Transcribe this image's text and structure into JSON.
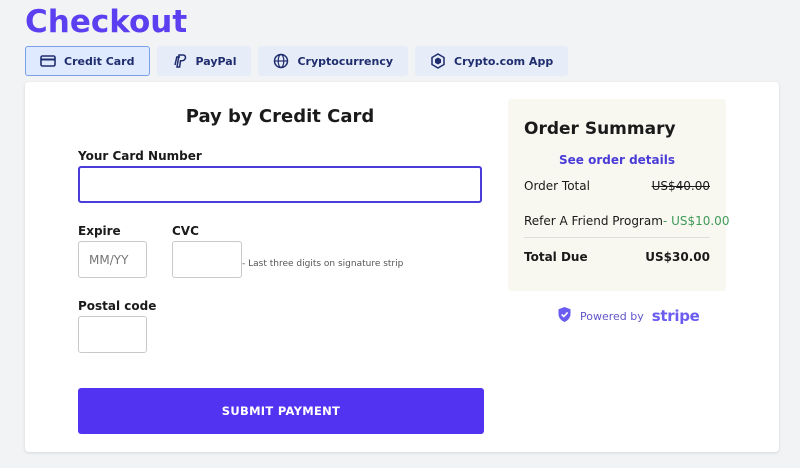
{
  "page": {
    "title": "Checkout"
  },
  "tabs": [
    {
      "label": "Credit Card",
      "icon": "credit-card-icon",
      "active": true
    },
    {
      "label": "PayPal",
      "icon": "paypal-icon",
      "active": false
    },
    {
      "label": "Cryptocurrency",
      "icon": "globe-icon",
      "active": false
    },
    {
      "label": "Crypto.com App",
      "icon": "crypto-com-icon",
      "active": false
    }
  ],
  "form": {
    "title": "Pay by Credit Card",
    "card_number": {
      "label": "Your Card Number",
      "value": "",
      "placeholder": ""
    },
    "expire": {
      "label": "Expire",
      "placeholder": "MM/YY"
    },
    "cvc": {
      "label": "CVC",
      "placeholder": "",
      "hint": "- Last three digits on signature strip"
    },
    "postal": {
      "label": "Postal code",
      "placeholder": ""
    },
    "submit_label": "SUBMIT PAYMENT"
  },
  "summary": {
    "title": "Order Summary",
    "details_link": "See order details",
    "order_total": {
      "label": "Order Total",
      "value": "US$40.00"
    },
    "referral": {
      "label": "Refer A Friend Program",
      "value": "- US$10.00"
    },
    "total_due": {
      "label": "Total Due",
      "value": "US$30.00"
    }
  },
  "powered_by": {
    "text": "Powered by",
    "brand": "stripe",
    "icon": "shield-check-icon"
  },
  "colors": {
    "accent": "#5233f2",
    "heading": "#5b3ff0",
    "discount": "#3f9a5a",
    "summary_bg": "#f8f8f0"
  }
}
